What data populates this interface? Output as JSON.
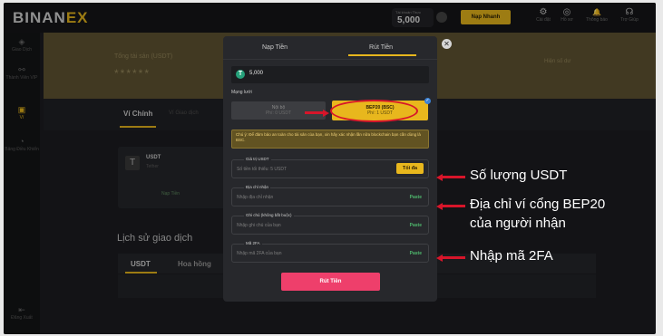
{
  "header": {
    "logo_main": "BINAN",
    "logo_accent": "EX",
    "balance_label": "Tài khoản Thực",
    "balance_value": "5,000",
    "deposit_button": "Nạp Nhanh",
    "icons": [
      {
        "icon": "gear-icon",
        "label": "Cài đặt",
        "glyph": "⚙"
      },
      {
        "icon": "user-icon",
        "label": "Hồ sơ",
        "glyph": "◎"
      },
      {
        "icon": "bell-icon",
        "label": "Thông báo",
        "glyph": "🔔"
      },
      {
        "icon": "headset-icon",
        "label": "Trợ Giúp",
        "glyph": "☊"
      }
    ]
  },
  "sidebar": {
    "items": [
      {
        "icon": "diamond-icon",
        "label": "Giao Dịch",
        "glyph": "◈"
      },
      {
        "icon": "share-icon",
        "label": "Thành Viên VIP",
        "glyph": "⚯"
      },
      {
        "icon": "wallet-icon",
        "label": "Ví",
        "glyph": "▣"
      },
      {
        "icon": "gauge-icon",
        "label": "Bảng Điều Khiển",
        "glyph": "◔"
      }
    ],
    "logout": {
      "icon": "logout-icon",
      "label": "Đăng Xuất",
      "glyph": "⇤"
    }
  },
  "banner": {
    "title": "Tổng tài sản (USDT)",
    "masked_value": "******",
    "hide_balance": "Hiện số dư"
  },
  "wallet_tabs": {
    "main": "Ví Chính",
    "other": "Ví Giao dịch"
  },
  "asset_card": {
    "symbol": "USDT",
    "name": "Tether",
    "deposit_link": "Nạp Tiền"
  },
  "history": {
    "title": "Lịch sử giao dịch",
    "tabs": [
      "USDT",
      "Hoa hồng"
    ]
  },
  "modal": {
    "tabs": [
      "Nạp Tiền",
      "Rút Tiền"
    ],
    "amount": "5,000",
    "network_label": "Mạng lưới",
    "network_options": [
      {
        "name": "Nội bộ",
        "fee": "Phí: 0 USDT"
      },
      {
        "name": "BEP20 (BSC)",
        "fee": "Phí: 1 USDT"
      }
    ],
    "note": "Chú ý: Để đảm bảo an toàn cho tài sản của bạn, xin hãy xác nhận lần nữa blockchain bạn cần dùng là BSC.",
    "fields": [
      {
        "label": "Giá trị USDT",
        "placeholder": "Số tiền tối thiểu: 5 USDT",
        "action": "Tối đa"
      },
      {
        "label": "Địa chỉ nhận",
        "placeholder": "Nhập địa chỉ nhận",
        "action": "Paste"
      },
      {
        "label": "Ghi chú (không bắt buộc)",
        "placeholder": "Nhập ghi chú của bạn",
        "action": "Paste"
      },
      {
        "label": "Mã 2FA",
        "placeholder": "Nhập mã 2FA của bạn",
        "action": "Paste"
      }
    ],
    "submit": "Rút Tiền",
    "close_glyph": "✕"
  },
  "annotations": {
    "usdt_amount": "Số lượng USDT",
    "address_line1": "Địa chỉ ví cổng BEP20",
    "address_line2": "của người nhận",
    "twofa": "Nhập mã 2FA"
  },
  "colors": {
    "accent": "#e8b71d",
    "submit": "#ee3f6b",
    "annotation_red": "#d7152a",
    "paste_green": "#4fb96d"
  }
}
